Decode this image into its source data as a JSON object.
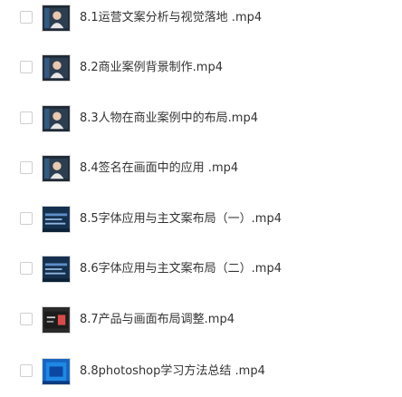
{
  "files": [
    {
      "name": "8.1运营文案分析与视觉落地 .mp4",
      "thumb_icon": "video-thumbnail-portrait-icon"
    },
    {
      "name": "8.2商业案例背景制作.mp4",
      "thumb_icon": "video-thumbnail-portrait-icon"
    },
    {
      "name": "8.3人物在商业案例中的布局.mp4",
      "thumb_icon": "video-thumbnail-portrait-icon"
    },
    {
      "name": "8.4签名在画面中的应用 .mp4",
      "thumb_icon": "video-thumbnail-portrait-icon"
    },
    {
      "name": "8.5字体应用与主文案布局（一）.mp4",
      "thumb_icon": "video-thumbnail-text-icon"
    },
    {
      "name": "8.6字体应用与主文案布局（二）.mp4",
      "thumb_icon": "video-thumbnail-text-icon"
    },
    {
      "name": "8.7产品与画面布局调整.mp4",
      "thumb_icon": "video-thumbnail-product-icon"
    },
    {
      "name": "8.8photoshop学习方法总结 .mp4",
      "thumb_icon": "video-thumbnail-blue-icon"
    }
  ]
}
